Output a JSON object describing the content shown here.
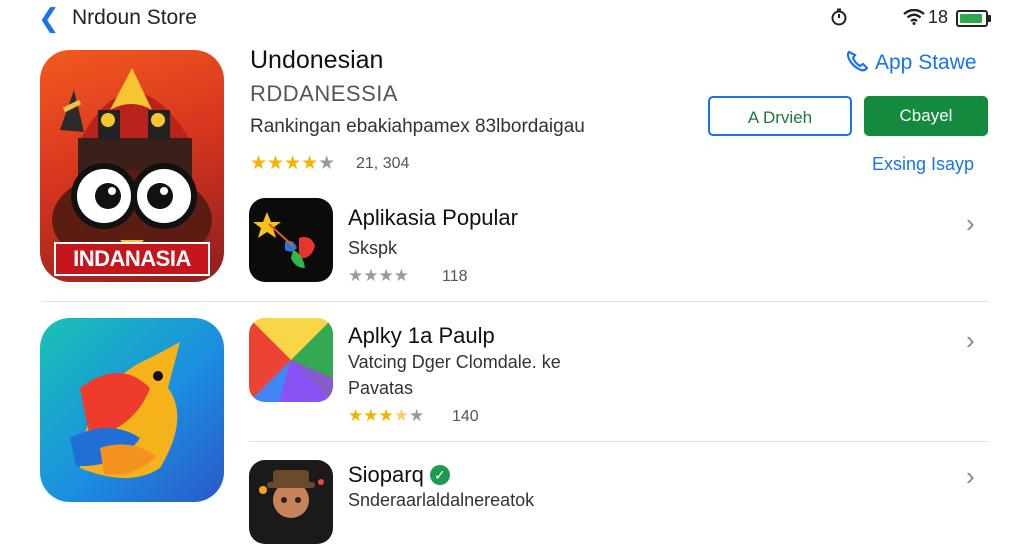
{
  "nav": {
    "back_icon": "chevron-left-icon",
    "title": "Nrdoun Store"
  },
  "status": {
    "signal_text": "18"
  },
  "app": {
    "title": "Undonesian",
    "subtitle": "RDDANESSIA",
    "description": "Rankingan ebakiahpamex 83lbordaigau",
    "rating_count": "21, 304",
    "rating": 4.5,
    "icon_banner": "INDANASIA",
    "store_link": "App Stawe",
    "secondary_button": "A Drvieh",
    "primary_button": "Cbayel",
    "more_link": "Exsing Isayp"
  },
  "list": [
    {
      "title": "Aplikasia Popular",
      "sub1": "Skspk",
      "rating": 4,
      "count": "118",
      "verified": false
    },
    {
      "title": "Aplky 1a Paulp",
      "sub1": "Vatcing Dger Clomdale. ke",
      "sub2": "Pavatas",
      "rating": 3.5,
      "count": "140",
      "verified": false
    },
    {
      "title": "Sioparq",
      "sub1": "Snderaarlaldalnereatok",
      "verified": true
    }
  ],
  "colors": {
    "accent": "#1a73e8",
    "primary_button": "#138a3e",
    "star": "#f5b301"
  }
}
